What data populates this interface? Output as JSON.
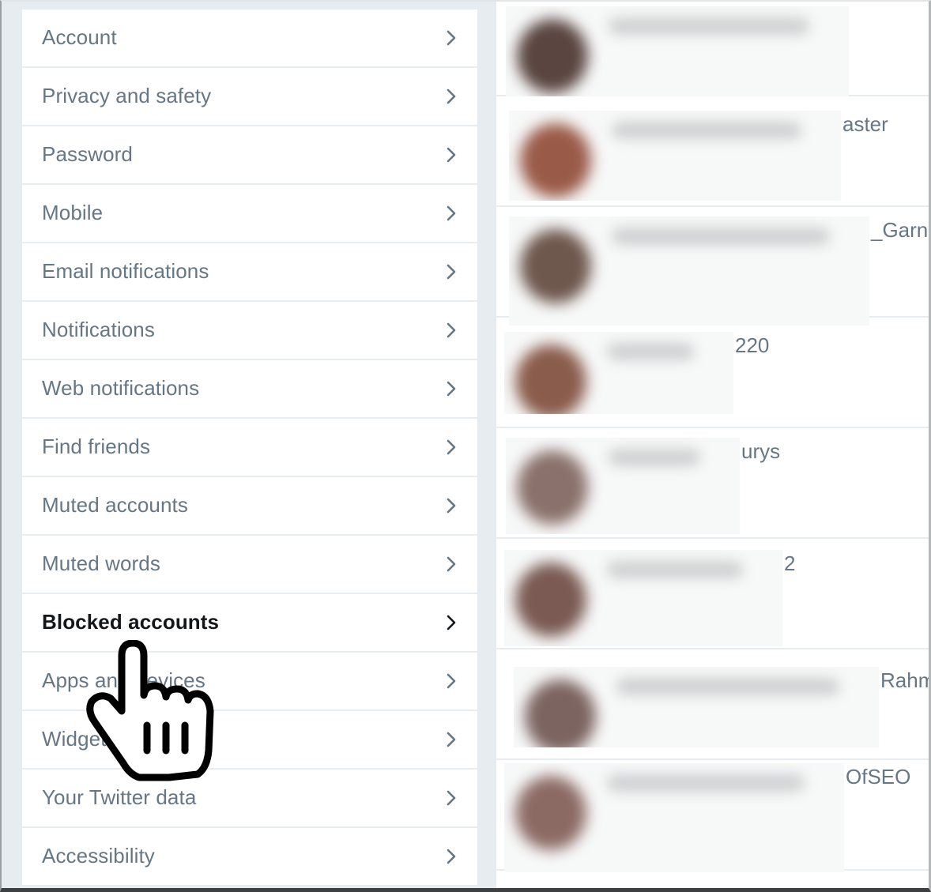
{
  "settings_menu": {
    "items": [
      {
        "label": "Account",
        "active": false
      },
      {
        "label": "Privacy and safety",
        "active": false
      },
      {
        "label": "Password",
        "active": false
      },
      {
        "label": "Mobile",
        "active": false
      },
      {
        "label": "Email notifications",
        "active": false
      },
      {
        "label": "Notifications",
        "active": false
      },
      {
        "label": "Web notifications",
        "active": false
      },
      {
        "label": "Find friends",
        "active": false
      },
      {
        "label": "Muted accounts",
        "active": false
      },
      {
        "label": "Muted words",
        "active": false
      },
      {
        "label": "Blocked accounts",
        "active": true
      },
      {
        "label": "Apps and devices",
        "active": false
      },
      {
        "label": "Widgets",
        "active": false
      },
      {
        "label": "Your Twitter data",
        "active": false
      },
      {
        "label": "Accessibility",
        "active": false
      }
    ],
    "chevron_icon": "chevron-right-icon"
  },
  "blocked_list": {
    "rows": [
      {
        "handle_visible": "",
        "avatar_color": "#5a4540"
      },
      {
        "handle_visible": "aster",
        "avatar_color": "#9a5a48"
      },
      {
        "handle_visible": "_Garnh",
        "avatar_color": "#6e574d"
      },
      {
        "handle_visible": "220",
        "avatar_color": "#8a5c4c"
      },
      {
        "handle_visible": "urys",
        "avatar_color": "#8a716b"
      },
      {
        "handle_visible": "2",
        "avatar_color": "#7a5a52"
      },
      {
        "handle_visible": "Rahm",
        "avatar_color": "#7c6460"
      },
      {
        "handle_visible": "OfSEO",
        "avatar_color": "#8c6a64"
      }
    ]
  },
  "colors": {
    "menu_text": "#657786",
    "menu_text_active": "#14171a",
    "background": "#e6ecf0"
  },
  "cursor": {
    "icon": "pointing-hand-cursor-icon"
  }
}
